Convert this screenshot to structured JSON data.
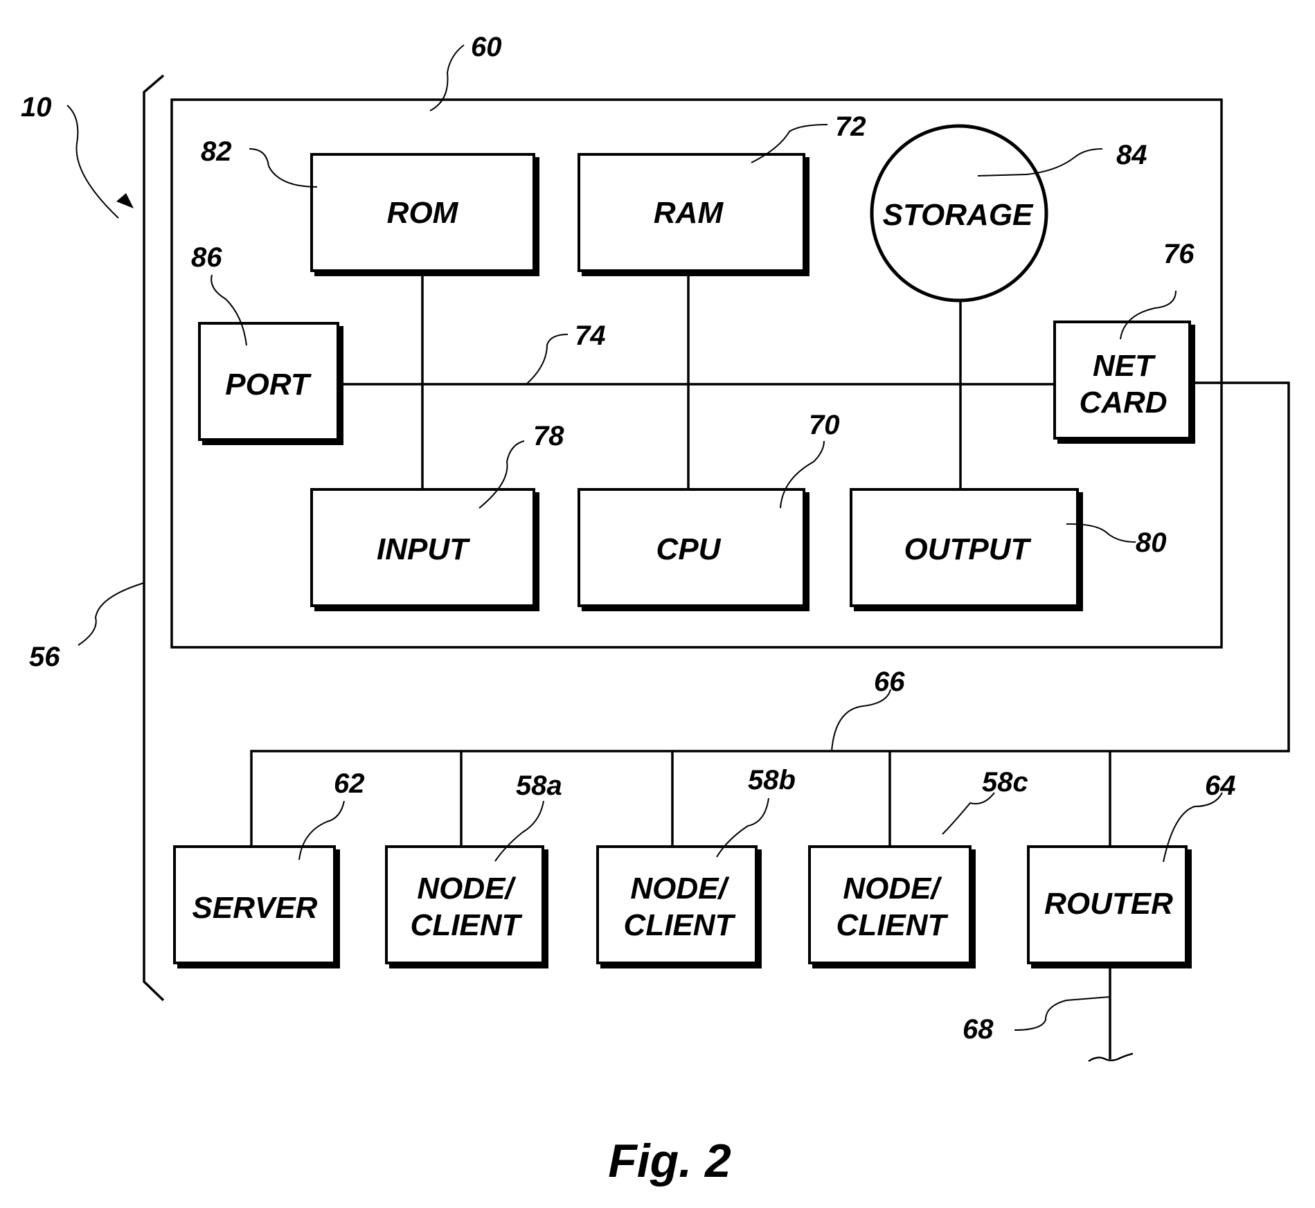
{
  "figure": {
    "caption": "Fig. 2",
    "system_ref": "10",
    "bracket_ref": "56",
    "computer_ref": "60",
    "bus_ref": "74",
    "network_ref": "66",
    "external_link_ref": "68"
  },
  "components": {
    "rom": {
      "label": "ROM",
      "ref": "82"
    },
    "ram": {
      "label": "RAM",
      "ref": "72"
    },
    "storage": {
      "label": "STORAGE",
      "ref": "84"
    },
    "port": {
      "label": "PORT",
      "ref": "86"
    },
    "netcard": {
      "label_line1": "NET",
      "label_line2": "CARD",
      "ref": "76"
    },
    "input": {
      "label": "INPUT",
      "ref": "78"
    },
    "cpu": {
      "label": "CPU",
      "ref": "70"
    },
    "output": {
      "label": "OUTPUT",
      "ref": "80"
    }
  },
  "network": {
    "server": {
      "label": "SERVER",
      "ref": "62"
    },
    "nodes": [
      {
        "label_line1": "NODE/",
        "label_line2": "CLIENT",
        "ref": "58a"
      },
      {
        "label_line1": "NODE/",
        "label_line2": "CLIENT",
        "ref": "58b"
      },
      {
        "label_line1": "NODE/",
        "label_line2": "CLIENT",
        "ref": "58c"
      }
    ],
    "router": {
      "label": "ROUTER",
      "ref": "64"
    }
  }
}
